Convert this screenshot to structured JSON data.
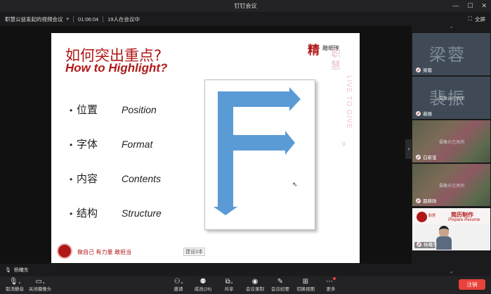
{
  "window": {
    "title": "钉钉会议"
  },
  "meeting": {
    "name": "职慧公益发起的视频会议",
    "duration": "01:06:04",
    "participants_status": "19人在会议中",
    "fullscreen_label": "全屏"
  },
  "slide": {
    "title_cn": "如何突出重点?",
    "title_en": "How to Highlight?",
    "bullets": [
      {
        "cn": "位置",
        "en": "Position"
      },
      {
        "cn": "字体",
        "en": "Format"
      },
      {
        "cn": "内容",
        "en": "Contents"
      },
      {
        "cn": "结构",
        "en": "Structure"
      }
    ],
    "brand_cn": "精",
    "brand_cn_small": "雕细琢",
    "watermark_cn": "职慧",
    "watermark_en": "LIVE TO GIVE",
    "watermark_arrow": "»",
    "footer_text": "做自己 有力量 敢担当",
    "footer_mark": "建设3本",
    "big_letter": "F"
  },
  "speaker": {
    "name": "杨曦东"
  },
  "participants": [
    {
      "name": "梁蓉",
      "initials": "梁蓉",
      "status": ""
    },
    {
      "name": "裴振",
      "initials": "裴振",
      "status": "摄像头已关闭"
    },
    {
      "name": "白家宝",
      "initials": "",
      "status": "摄像头已关闭"
    },
    {
      "name": "聂耕政",
      "initials": "",
      "status": "摄像头已关闭"
    },
    {
      "name": "杨曦东",
      "initials": "",
      "status": ""
    }
  ],
  "active_tile": {
    "banner_title": "简历制作",
    "banner_sub": "Prepare Resume",
    "logo_text": "职慧"
  },
  "toolbar": {
    "mute": "取消静音",
    "camera": "关闭摄像头",
    "invite": "邀请",
    "members": "成员(26)",
    "share": "共享",
    "record": "会议录制",
    "minutes": "会议纪要",
    "layout": "切换视图",
    "more": "更多",
    "end": "注销"
  },
  "colors": {
    "accent_red": "#b01818",
    "end_button": "#e8423b",
    "f_arrow": "#5b9bd5"
  }
}
